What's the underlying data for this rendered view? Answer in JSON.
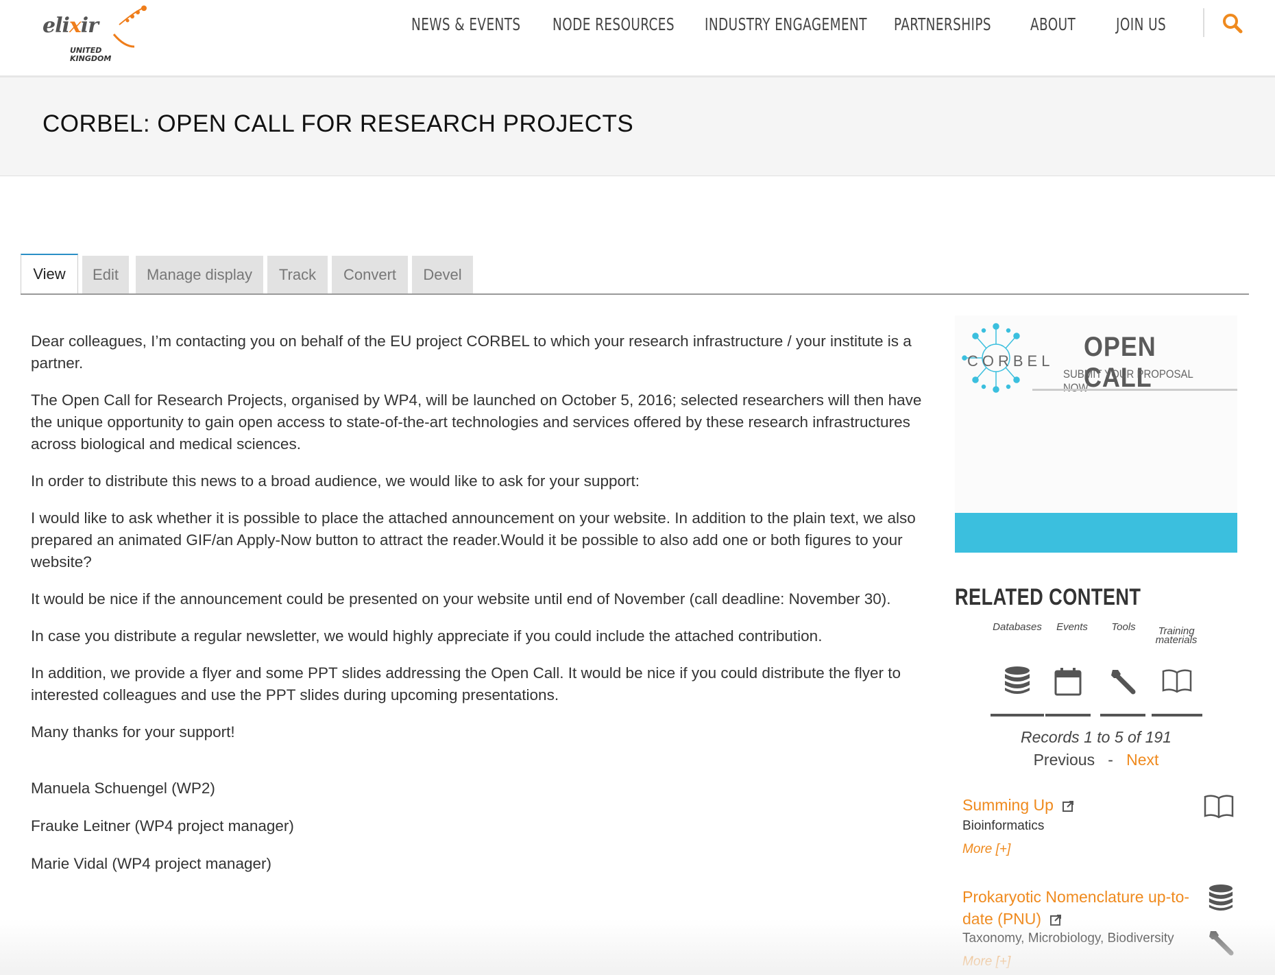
{
  "header": {
    "logo": {
      "word": "elixir",
      "sub_line1": "UNITED",
      "sub_line2": "KINGDOM"
    },
    "nav": [
      "NEWS & EVENTS",
      "NODE RESOURCES",
      "INDUSTRY ENGAGEMENT",
      "PARTNERSHIPS",
      "ABOUT",
      "JOIN US"
    ],
    "search_icon": "search-icon"
  },
  "page": {
    "title": "CORBEL: OPEN CALL FOR RESEARCH PROJECTS"
  },
  "tabs": [
    "View",
    "Edit",
    "Manage display",
    "Track",
    "Convert",
    "Devel"
  ],
  "active_tab": "View",
  "body": {
    "paragraphs": [
      "Dear colleagues, I’m contacting you on behalf of the EU project CORBEL to which your research infrastructure / your institute is a partner.",
      "The Open Call for Research Projects, organised by WP4, will be launched on October 5, 2016; selected researchers will then have the unique opportunity to gain open access to state-of-the-art technologies and services offered by these research infrastructures across biological and medical sciences.",
      "In order to distribute this news to a broad audience, we would like to ask for your support:",
      "I would like to ask whether it is possible to place the attached announcement on your website. In addition to the plain text, we also prepared an animated GIF/an Apply-Now button to attract the reader.Would it be possible to also add one or both figures to your website?",
      "It would be nice if the announcement could be presented on your website until end of November (call deadline: November 30).",
      "In case you distribute a regular newsletter, we would highly appreciate if you could include the attached contribution.",
      "In addition, we provide a flyer and some PPT slides addressing the Open Call. It would be nice if you could distribute the flyer to interested colleagues and use the PPT slides during upcoming presentations.",
      "Many thanks for your support!"
    ],
    "signatures": [
      "Manuela Schuengel (WP2)",
      "Frauke Leitner (WP4 project manager)",
      "Marie Vidal (WP4 project manager)"
    ]
  },
  "banner": {
    "logo_text": "CORBEL",
    "headline": "OPEN CALL",
    "subline": "SUBMIT YOUR PROPOSAL NOW",
    "accent_color": "#3bbfde"
  },
  "related": {
    "title": "RELATED CONTENT",
    "categories": [
      {
        "label": "Databases",
        "icon": "database-icon"
      },
      {
        "label": "Events",
        "icon": "calendar-icon"
      },
      {
        "label": "Tools",
        "icon": "wrench-icon"
      },
      {
        "label": "Training materials",
        "icon": "book-icon"
      }
    ],
    "records": "Records 1 to 5 of 191",
    "pager": {
      "previous": "Previous",
      "separator": "-",
      "next": "Next"
    },
    "items": [
      {
        "title": "Summing Up",
        "category": "Bioinformatics",
        "more": "More [+]",
        "icons": [
          "book-icon"
        ]
      },
      {
        "title_line1": "Prokaryotic Nomenclature up-to-",
        "title_line2": "date (PNU)",
        "category": "Taxonomy, Microbiology, Biodiversity",
        "more": "More [+]",
        "icons": [
          "database-icon",
          "wrench-icon"
        ]
      }
    ]
  },
  "colors": {
    "accent": "#ef8a1e",
    "tab_active_border": "#2a8fc6"
  }
}
